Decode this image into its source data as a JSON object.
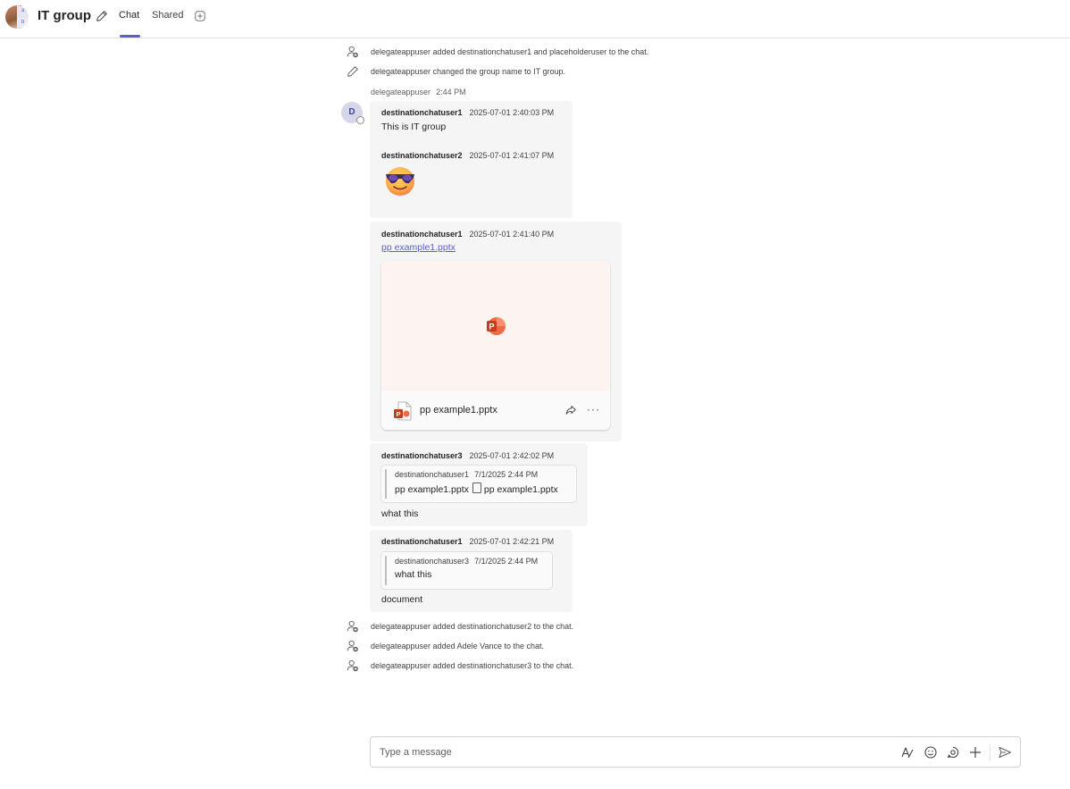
{
  "header": {
    "title": "IT group",
    "avatar_initials": [
      "a",
      "b"
    ],
    "tabs": [
      {
        "label": "Chat",
        "selected": true
      },
      {
        "label": "Shared",
        "selected": false
      }
    ]
  },
  "events_top": [
    {
      "icon": "person-add-icon",
      "text": "delegateappuser added destinationchatuser1 and placeholderuser to the chat."
    },
    {
      "icon": "pencil-icon",
      "text": "delegateappuser changed the group name to IT group."
    }
  ],
  "sender_line": {
    "name": "delegateappuser",
    "time": "2:44 PM"
  },
  "avatar": {
    "initial": "D"
  },
  "messages": [
    {
      "name": "destinationchatuser1",
      "time": "2025-07-01 2:40:03 PM",
      "text": "This is IT group"
    },
    {
      "name": "destinationchatuser2",
      "time": "2025-07-01 2:41:07 PM",
      "emoji": "cool-emoji"
    },
    {
      "name": "destinationchatuser1",
      "time": "2025-07-01 2:41:40 PM",
      "link": "pp example1.pptx",
      "attachment": {
        "file_name": "pp example1.pptx"
      }
    },
    {
      "name": "destinationchatuser3",
      "time": "2025-07-01 2:42:02 PM",
      "quote": {
        "name": "destinationchatuser1",
        "time": "7/1/2025 2:44 PM",
        "text_before": "pp example1.pptx",
        "text_after": "pp example1.pptx"
      },
      "text": "what this"
    },
    {
      "name": "destinationchatuser1",
      "time": "2025-07-01 2:42:21 PM",
      "quote": {
        "name": "destinationchatuser3",
        "time": "7/1/2025 2:44 PM",
        "text": "what this"
      },
      "text": "document"
    }
  ],
  "events_bottom": [
    {
      "icon": "person-add-icon",
      "text": "delegateappuser added destinationchatuser2 to the chat."
    },
    {
      "icon": "person-add-icon",
      "text": "delegateappuser added Adele Vance to the chat."
    },
    {
      "icon": "person-add-icon",
      "text": "delegateappuser added destinationchatuser3 to the chat."
    }
  ],
  "compose": {
    "placeholder": "Type a message"
  },
  "colors": {
    "accent": "#5b5fc7",
    "bubble": "#f5f5f5",
    "ppt": "#c43e1c"
  }
}
